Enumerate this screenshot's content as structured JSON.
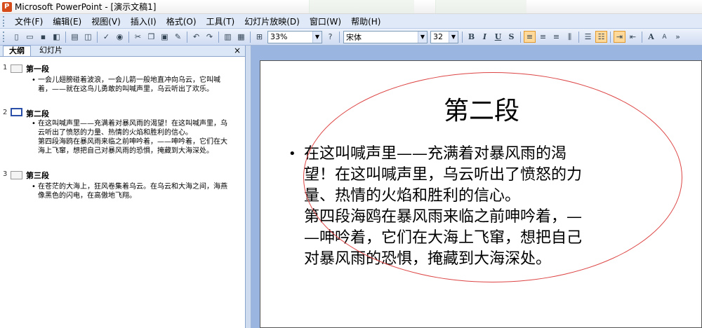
{
  "window": {
    "title": "Microsoft PowerPoint - [演示文稿1]"
  },
  "menu": {
    "items": [
      "文件(F)",
      "编辑(E)",
      "视图(V)",
      "插入(I)",
      "格式(O)",
      "工具(T)",
      "幻灯片放映(D)",
      "窗口(W)",
      "帮助(H)"
    ]
  },
  "toolbar": {
    "zoom": "33%",
    "font": "宋体",
    "font_size": "32",
    "bold": "B",
    "italic": "I",
    "underline": "U",
    "shadow": "S",
    "grow_font": "A",
    "shrink_font": "A"
  },
  "left_pane": {
    "tabs": {
      "outline": "大纲",
      "slides": "幻灯片"
    },
    "close": "×",
    "slides": [
      {
        "number": "1",
        "title": "第一段",
        "lines": [
          "一会儿翅膀碰着波浪，一会儿箭一般地直冲向乌云，它叫喊",
          "着，——就在这鸟儿勇敢的叫喊声里，乌云听出了欢乐。"
        ],
        "selected": false
      },
      {
        "number": "2",
        "title": "第二段",
        "lines": [
          "在这叫喊声里——充满着对暴风雨的渴望！在这叫喊声里，乌",
          "云听出了愤怒的力量、热情的火焰和胜利的信心。",
          "第四段海鸥在暴风雨来临之前呻吟着，——呻吟着，它们在大",
          "海上飞窜，想把自己对暴风雨的恐惧，掩藏到大海深处。"
        ],
        "selected": true
      },
      {
        "number": "3",
        "title": "第三段",
        "lines": [
          "在苍茫的大海上，狂风卷集着乌云。在乌云和大海之间，海燕",
          "像黑色的闪电，在高傲地飞翔。"
        ],
        "selected": false
      }
    ]
  },
  "slide": {
    "title": "第二段",
    "bullet": "•",
    "lines": [
      "在这叫喊声里——充满着对暴风雨的渴",
      "望！在这叫喊声里，乌云听出了愤怒的力",
      "量、热情的火焰和胜利的信心。",
      "第四段海鸥在暴风雨来临之前呻吟着，—",
      "—呻吟着，它们在大海上飞窜，想把自己",
      "对暴风雨的恐惧，掩藏到大海深处。"
    ]
  },
  "colors": {
    "accent": "#2a4fa8",
    "oval": "#dd4444",
    "workspace": "#9ab5e0"
  }
}
